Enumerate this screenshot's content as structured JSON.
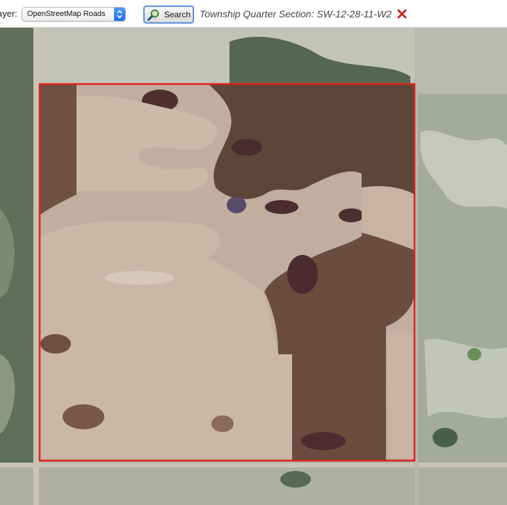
{
  "toolbar": {
    "layer_label": "ayer:",
    "layer_select_value": "OpenStreetMap Roads",
    "search_label": "Search",
    "result_text": "Township Quarter Section: SW-12-28-11-W2"
  },
  "map": {
    "highlight_color": "#e02020",
    "icons": {
      "search": "magnifier-icon",
      "clear": "close-icon",
      "select": "select-arrows-icon"
    }
  }
}
